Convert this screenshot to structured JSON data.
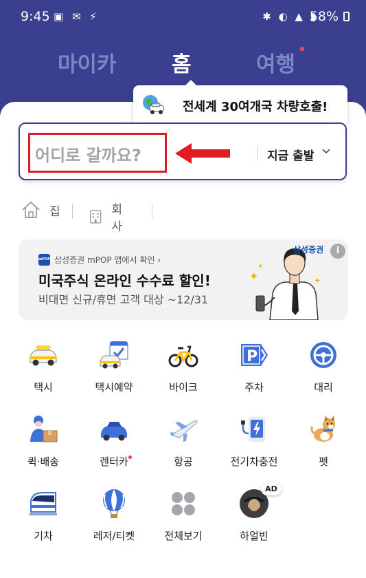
{
  "status_bar": {
    "time": "9:45",
    "battery": "58%"
  },
  "tabs": [
    {
      "label": "마이카"
    },
    {
      "label": "홈"
    },
    {
      "label": "여행"
    }
  ],
  "tooltip": {
    "text": "전세계 30여개국 차량호출!"
  },
  "search": {
    "placeholder": "어디로 갈까요?",
    "depart_label": "지금 출발"
  },
  "places": [
    {
      "label": "집"
    },
    {
      "label": "회사"
    }
  ],
  "banner": {
    "source": "삼성증권 mPOP 앱에서 확인 ›",
    "logo_text": "mPOP",
    "title": "미국주식 온라인 수수료 할인!",
    "subtitle": "비대면 신규/휴면 고객 대상 ~12/31",
    "brand": "삼성증권",
    "info": "i"
  },
  "services": [
    {
      "label": "택시"
    },
    {
      "label": "택시예약"
    },
    {
      "label": "바이크"
    },
    {
      "label": "주차"
    },
    {
      "label": "대리"
    },
    {
      "label": "퀵·배송"
    },
    {
      "label": "렌터카"
    },
    {
      "label": "항공"
    },
    {
      "label": "전기차충전"
    },
    {
      "label": "펫"
    },
    {
      "label": "기차"
    },
    {
      "label": "레저/티켓"
    },
    {
      "label": "전체보기"
    },
    {
      "label": "하얼빈",
      "badge": "AD"
    }
  ],
  "colors": {
    "header": "#3a3f8f",
    "highlight": "#e01b22",
    "accent_dot": "#ff4b4b"
  }
}
